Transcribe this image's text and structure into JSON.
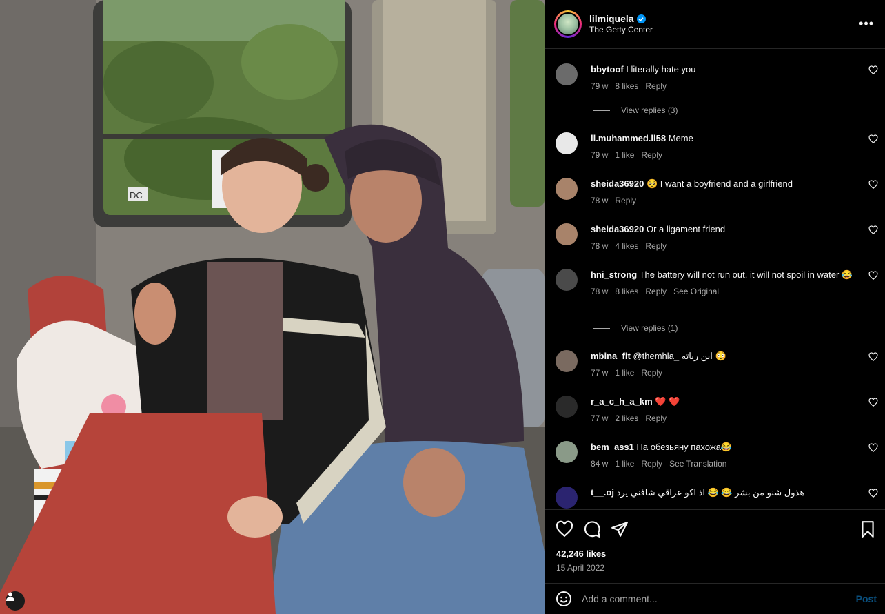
{
  "post": {
    "username": "lilmiquela",
    "location": "The Getty Center",
    "verified": true,
    "likes": "42,246 likes",
    "date": "15 April 2022"
  },
  "photo": {
    "sign_text": "DC"
  },
  "comments": [
    {
      "user": "bbytoof",
      "text": "I literally hate you",
      "time": "79 w",
      "likes": "8 likes",
      "actions": [
        "Reply"
      ],
      "replies": "View replies (3)",
      "avatar_color": "#6b6b6b"
    },
    {
      "user": "ll.muhammed.ll58",
      "text": "Meme",
      "time": "79 w",
      "likes": "1 like",
      "actions": [
        "Reply"
      ],
      "replies": "",
      "avatar_color": "#e8e8e8"
    },
    {
      "user": "sheida36920",
      "text": "🥺 I want a boyfriend and a girlfriend",
      "time": "78 w",
      "likes": "",
      "actions": [
        "Reply"
      ],
      "replies": "",
      "avatar_color": "#a8836a"
    },
    {
      "user": "sheida36920",
      "text": "Or a ligament friend",
      "time": "78 w",
      "likes": "4 likes",
      "actions": [
        "Reply"
      ],
      "replies": "",
      "avatar_color": "#a8836a"
    },
    {
      "user": "hni_strong",
      "text": "The battery will not run out, it will not spoil in water 😂",
      "time": "78 w",
      "likes": "8 likes",
      "actions": [
        "Reply",
        "See Original"
      ],
      "replies": "View replies (1)",
      "avatar_color": "#4a4a4a"
    },
    {
      "user": "mbina_fit",
      "text": "@themhla_ این رباته 😳",
      "time": "77 w",
      "likes": "1 like",
      "actions": [
        "Reply"
      ],
      "replies": "",
      "avatar_color": "#7a6a60"
    },
    {
      "user": "r_a_c_h_a_km",
      "text": "❤️ ❤️",
      "time": "77 w",
      "likes": "2 likes",
      "actions": [
        "Reply"
      ],
      "replies": "",
      "avatar_color": "#2a2a2a"
    },
    {
      "user": "bem_ass1",
      "text": "На обезьяну пахожа😂",
      "time": "84 w",
      "likes": "1 like",
      "actions": [
        "Reply",
        "See Translation"
      ],
      "replies": "",
      "avatar_color": "#8a9a88"
    },
    {
      "user": "t__.oj",
      "text": "هذول شنو من بشر 😂 😂 اذ اكو عراقي شافني يرد",
      "time": "",
      "likes": "",
      "actions": [],
      "replies": "",
      "avatar_color": "#2b2470"
    }
  ],
  "add_comment": {
    "placeholder": "Add a comment...",
    "post_label": "Post"
  },
  "colors": {
    "accent": "#0095f6",
    "muted": "#a8a8a8",
    "divider": "#262626"
  },
  "icons": [
    "heart-icon",
    "comment-icon",
    "share-icon",
    "bookmark-icon",
    "emoji-icon",
    "more-options-icon",
    "verified-badge-icon",
    "user-tag-icon"
  ]
}
